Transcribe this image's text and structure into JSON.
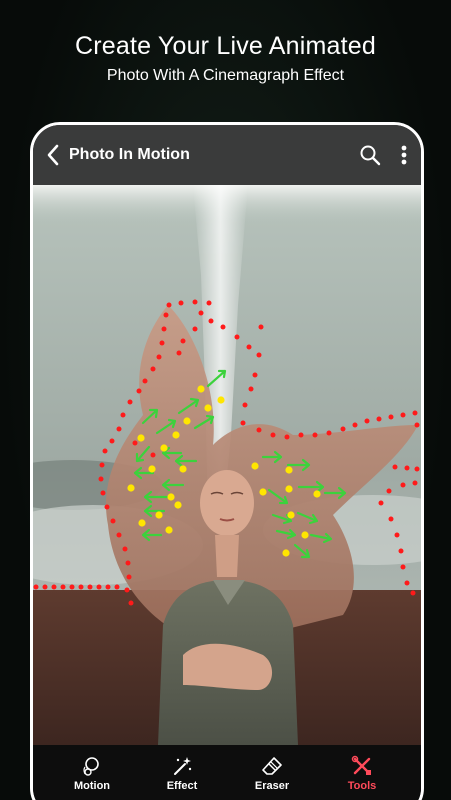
{
  "promo": {
    "title": "Create Your Live Animated",
    "subtitle": "Photo With A Cinemagraph Effect"
  },
  "appbar": {
    "title": "Photo In Motion",
    "back_icon": "chevron-left-icon",
    "search_icon": "search-icon",
    "menu_icon": "more-vertical-icon"
  },
  "toolbar": {
    "items": [
      {
        "label": "Motion",
        "icon": "motion-icon",
        "active": false
      },
      {
        "label": "Effect",
        "icon": "magic-wand-icon",
        "active": false
      },
      {
        "label": "Eraser",
        "icon": "eraser-icon",
        "active": false
      },
      {
        "label": "Tools",
        "icon": "tools-icon",
        "active": true
      }
    ]
  },
  "colors": {
    "mask_points": "#ff1a1a",
    "anchor_points": "#ffe600",
    "motion_arrows": "#3cd23c",
    "active_tool": "#ff4a5a",
    "appbar": "#3a3b3b"
  }
}
